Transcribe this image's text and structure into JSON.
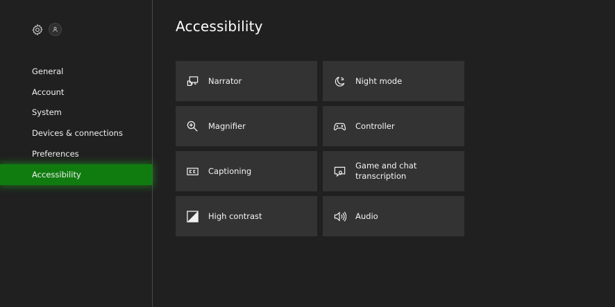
{
  "header": {
    "settings_icon": "gear-icon",
    "profile_icon": "person-icon"
  },
  "sidebar": {
    "items": [
      {
        "label": "General",
        "active": false
      },
      {
        "label": "Account",
        "active": false
      },
      {
        "label": "System",
        "active": false
      },
      {
        "label": "Devices & connections",
        "active": false
      },
      {
        "label": "Preferences",
        "active": false
      },
      {
        "label": "Accessibility",
        "active": true
      }
    ]
  },
  "main": {
    "title": "Accessibility",
    "tiles": [
      {
        "label": "Narrator",
        "icon": "narrator-icon"
      },
      {
        "label": "Night mode",
        "icon": "night-mode-icon"
      },
      {
        "label": "Magnifier",
        "icon": "magnifier-icon"
      },
      {
        "label": "Controller",
        "icon": "controller-icon"
      },
      {
        "label": "Captioning",
        "icon": "captioning-icon"
      },
      {
        "label": "Game and chat\ntranscription",
        "icon": "transcription-icon"
      },
      {
        "label": "High contrast",
        "icon": "high-contrast-icon"
      },
      {
        "label": "Audio",
        "icon": "audio-icon"
      }
    ]
  },
  "colors": {
    "background": "#202020",
    "tile": "#333333",
    "accent": "#107c10",
    "divider": "#4a4a4a",
    "text": "#ffffff"
  }
}
